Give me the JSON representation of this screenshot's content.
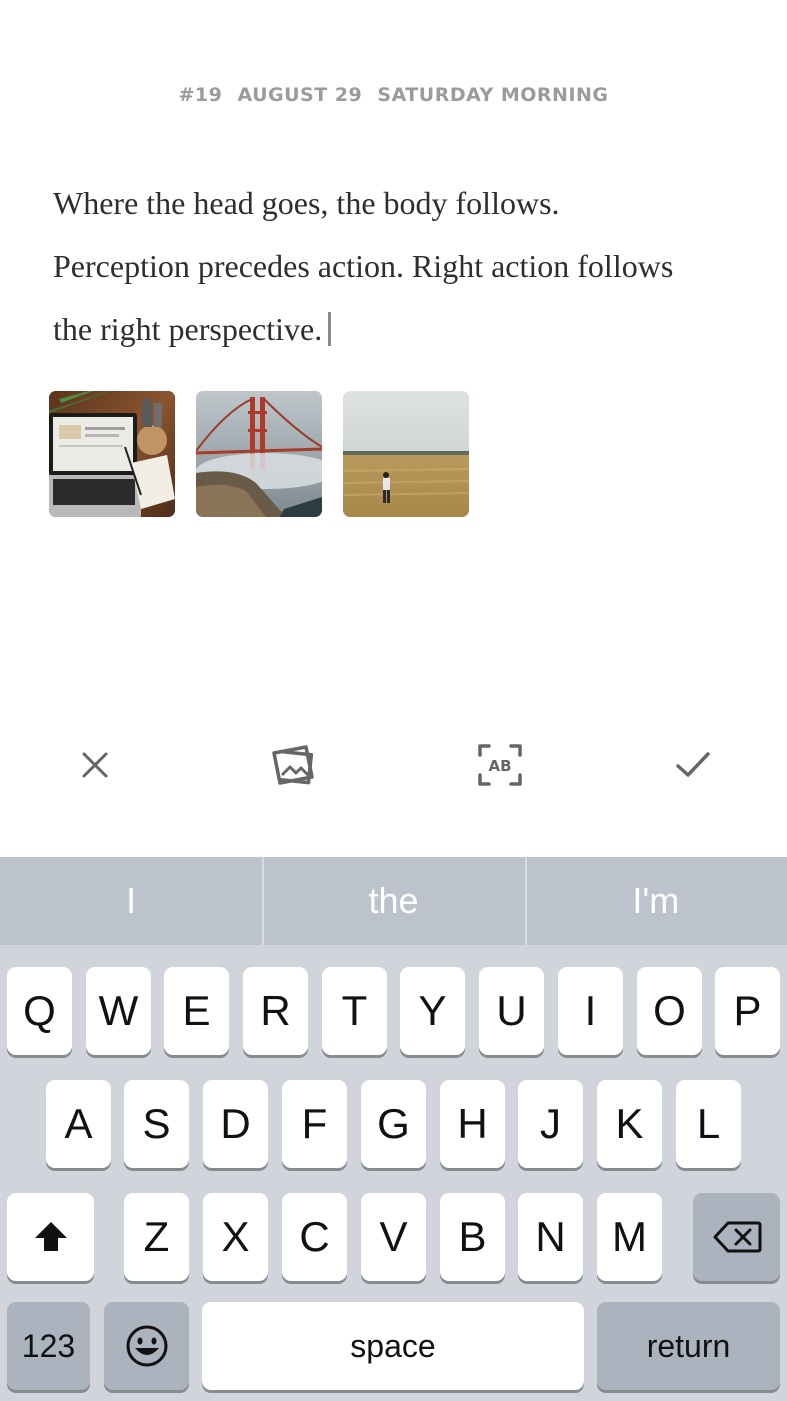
{
  "entry": {
    "number": "#19",
    "date": "AUGUST 29",
    "time_of_day": "SATURDAY MORNING",
    "lines": [
      "Where the head goes, the body follows.",
      "Perception precedes action. Right action follows",
      "the right perspective."
    ]
  },
  "attachments": [
    {
      "name": "laptop-desk-photo"
    },
    {
      "name": "golden-gate-bridge-photo"
    },
    {
      "name": "wheat-field-person-photo"
    }
  ],
  "toolbar": {
    "cancel_icon": "close-icon",
    "photo_icon": "photo-gallery-icon",
    "text_style_icon": "ab-format-icon",
    "done_icon": "checkmark-icon"
  },
  "keyboard": {
    "suggestions": [
      "I",
      "the",
      "I'm"
    ],
    "row1": [
      "Q",
      "W",
      "E",
      "R",
      "T",
      "Y",
      "U",
      "I",
      "O",
      "P"
    ],
    "row2": [
      "A",
      "S",
      "D",
      "F",
      "G",
      "H",
      "J",
      "K",
      "L"
    ],
    "row3": [
      "Z",
      "X",
      "C",
      "V",
      "B",
      "N",
      "M"
    ],
    "numbers_label": "123",
    "space_label": "space",
    "return_label": "return"
  }
}
